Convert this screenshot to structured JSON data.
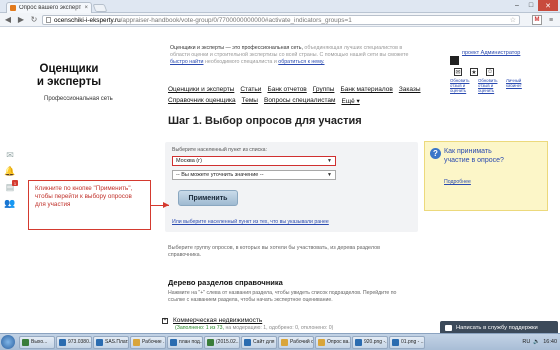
{
  "browser": {
    "tab_title": "Опрос вашего экспертного...",
    "url_host": "ocenschiki-i-eksperty.ru",
    "url_path": "/appraiser-handbook/vote-group/0/7700000000000#activate_indicators_groups=1",
    "close_glyph": "✕",
    "minimize_glyph": "–",
    "maximize_glyph": "□"
  },
  "logo": {
    "line1": "Оценщики",
    "line2": "и эксперты",
    "subtitle": "Профессиональная сеть"
  },
  "intro": {
    "lead": "Оценщики и эксперты — это профессиональная сеть,",
    "rest": " объединяющая лучших специалистов в области оценки и строительной экспертизы со всей страны. С помощью нашей сети вы сможете ",
    "link1": "быстро найти",
    "mid": " необходимого специалиста и ",
    "link2": "обратиться к нему."
  },
  "user": {
    "admin_link": "проект Администратор",
    "links": [
      "Обновить отзыв и оценить",
      "Обновить отзыв и оценить",
      "Личный кабинет"
    ]
  },
  "menu": {
    "row1": [
      "Оценщики и эксперты",
      "Статьи",
      "Банк отчетов",
      "Группы",
      "Банк материалов",
      "Заказы"
    ],
    "row2": [
      "Справочник оценщика",
      "Темы",
      "Вопросы специалистам",
      "Ещё ▾"
    ]
  },
  "heading": "Шаг 1. Выбор опросов для участия",
  "form": {
    "city_label": "Выберите населенный пункт из списка:",
    "city_value": "Москва (г)",
    "refine_value": "-- Вы можете уточнить значение --",
    "apply_label": "Применить",
    "hint": "Или выберите населенный пункт из тех, что вы указывали ранее"
  },
  "callout": "Кликните по кнопке \"Применить\", чтобы перейти к выбору опросов для участия",
  "tip": {
    "title": "Как принимать участие в опросе?",
    "more": "Подробнее"
  },
  "choose_text": "Выберите группу опросов, в которых вы хотели бы участвовать, из дерева разделов справочника.",
  "tree": {
    "heading": "Дерево разделов справочника",
    "desc": "Нажмите на \"+\" слева от названия раздела, чтобы увидеть список подразделов. Перейдите по ссылке с названием раздела, чтобы начать экспертное оценивание.",
    "item_name": "Коммерческая недвижимость",
    "item_stat_green": "(Заполнено: 1 из 73,",
    "item_stat_gray": " на модерацию: 1, одобрено: 0, отклонено: 0)"
  },
  "chat": "Написать в службу поддержки",
  "taskbar": {
    "items": [
      {
        "label": "Выхо...",
        "color": "#3a7d3a"
      },
      {
        "label": "973.0380...",
        "color": "#2b6cb0"
      },
      {
        "label": "SAS.Плат...",
        "color": "#2b6cb0"
      },
      {
        "label": "Рабочие ...",
        "color": "#d9a53a"
      },
      {
        "label": "план под...",
        "color": "#2b6cb0"
      },
      {
        "label": "(2015.02...",
        "color": "#3a7d3a"
      },
      {
        "label": "Сайт для ...",
        "color": "#2b6cb0"
      },
      {
        "label": "Рабочий с...",
        "color": "#d9a53a"
      },
      {
        "label": "Опрос ва...",
        "color": "#d9a53a"
      },
      {
        "label": "920.png -...",
        "color": "#2b6cb0"
      },
      {
        "label": "01.png - ...",
        "color": "#2b6cb0"
      }
    ],
    "lang": "RU",
    "time": "16:40"
  }
}
